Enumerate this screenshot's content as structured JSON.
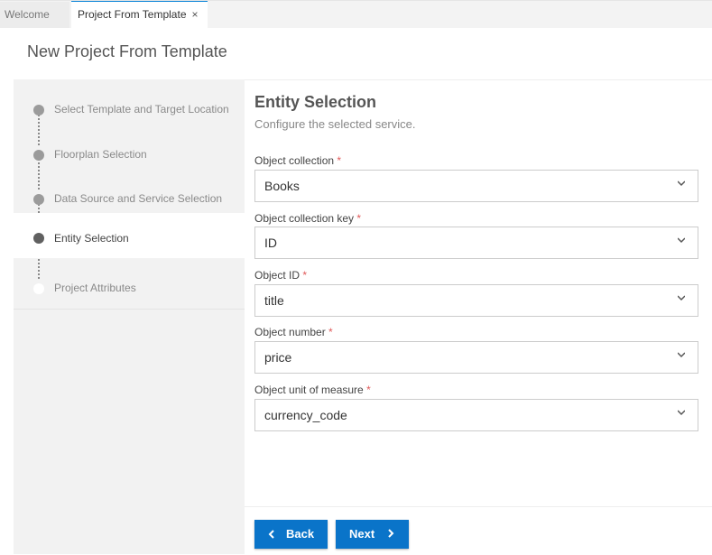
{
  "tabs": [
    {
      "label": "Welcome"
    },
    {
      "label": "Project From Template",
      "close": "×"
    }
  ],
  "page": {
    "title": "New Project From Template"
  },
  "steps": [
    {
      "label": "Select Template and Target Location",
      "state": "done"
    },
    {
      "label": "Floorplan Selection",
      "state": "done"
    },
    {
      "label": "Data Source and Service Selection",
      "state": "done"
    },
    {
      "label": "Entity Selection",
      "state": "active"
    },
    {
      "label": "Project Attributes",
      "state": "pending"
    }
  ],
  "section": {
    "title": "Entity Selection",
    "subtitle": "Configure the selected service."
  },
  "fields": [
    {
      "label": "Object collection",
      "required": "*",
      "value": "Books"
    },
    {
      "label": "Object collection key",
      "required": "*",
      "value": "ID"
    },
    {
      "label": "Object ID",
      "required": "*",
      "value": "title"
    },
    {
      "label": "Object number",
      "required": "*",
      "value": "price"
    },
    {
      "label": "Object unit of measure",
      "required": "*",
      "value": "currency_code"
    }
  ],
  "buttons": {
    "back": "Back",
    "next": "Next"
  }
}
